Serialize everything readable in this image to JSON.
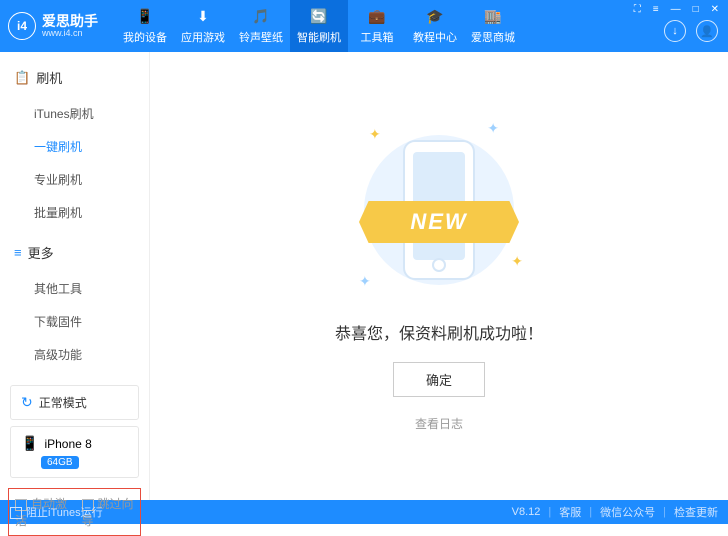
{
  "app": {
    "name": "爱思助手",
    "url": "www.i4.cn",
    "logo_text": "i4"
  },
  "windowControls": {
    "gift": "⛶",
    "menu": "≡",
    "min": "—",
    "max": "□",
    "close": "✕"
  },
  "nav": [
    {
      "icon": "📱",
      "label": "我的设备"
    },
    {
      "icon": "⬇",
      "label": "应用游戏"
    },
    {
      "icon": "🎵",
      "label": "铃声壁纸"
    },
    {
      "icon": "🔄",
      "label": "智能刷机",
      "active": true
    },
    {
      "icon": "💼",
      "label": "工具箱"
    },
    {
      "icon": "🎓",
      "label": "教程中心"
    },
    {
      "icon": "🏬",
      "label": "爱思商城"
    }
  ],
  "headerBtns": {
    "download": "↓",
    "user": "👤"
  },
  "sidebar": {
    "sections": [
      {
        "title": "刷机",
        "icon": "📋",
        "items": [
          {
            "label": "iTunes刷机"
          },
          {
            "label": "一键刷机",
            "active": true
          },
          {
            "label": "专业刷机"
          },
          {
            "label": "批量刷机"
          }
        ]
      },
      {
        "title": "更多",
        "icon": "≡",
        "items": [
          {
            "label": "其他工具"
          },
          {
            "label": "下载固件"
          },
          {
            "label": "高级功能"
          }
        ]
      }
    ],
    "mode": {
      "label": "正常模式"
    },
    "device": {
      "name": "iPhone 8",
      "storage": "64GB"
    },
    "checks": {
      "auto": "自动激活",
      "skip": "跳过向导"
    }
  },
  "main": {
    "ribbon": "NEW",
    "message": "恭喜您，保资料刷机成功啦！",
    "ok": "确定",
    "log": "查看日志"
  },
  "footer": {
    "block_itunes": "阻止iTunes运行",
    "version": "V8.12",
    "support": "客服",
    "wechat": "微信公众号",
    "update": "检查更新"
  }
}
